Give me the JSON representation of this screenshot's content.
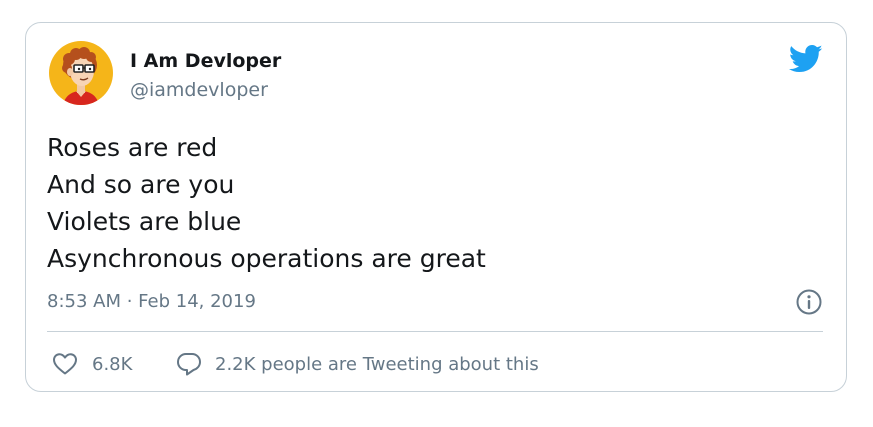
{
  "tweet": {
    "user": {
      "name": "I Am Devloper",
      "handle": "@iamdevloper"
    },
    "lines": [
      "Roses are red",
      "And so are you",
      "Violets are blue",
      "Asynchronous operations are great"
    ],
    "timestamp": "8:53 AM · Feb 14, 2019",
    "likes_count": "6.8K",
    "replies_text": "2.2K people are Tweeting about this"
  },
  "icons": {
    "brand": "twitter-bird-icon",
    "info": "info-icon",
    "like": "heart-icon",
    "reply": "speech-bubble-icon"
  },
  "colors": {
    "brand": "#1da1f2",
    "text": "#14171a",
    "secondary_text": "#657786",
    "border": "#c7d1d8",
    "avatar_background": "#f5b519"
  }
}
